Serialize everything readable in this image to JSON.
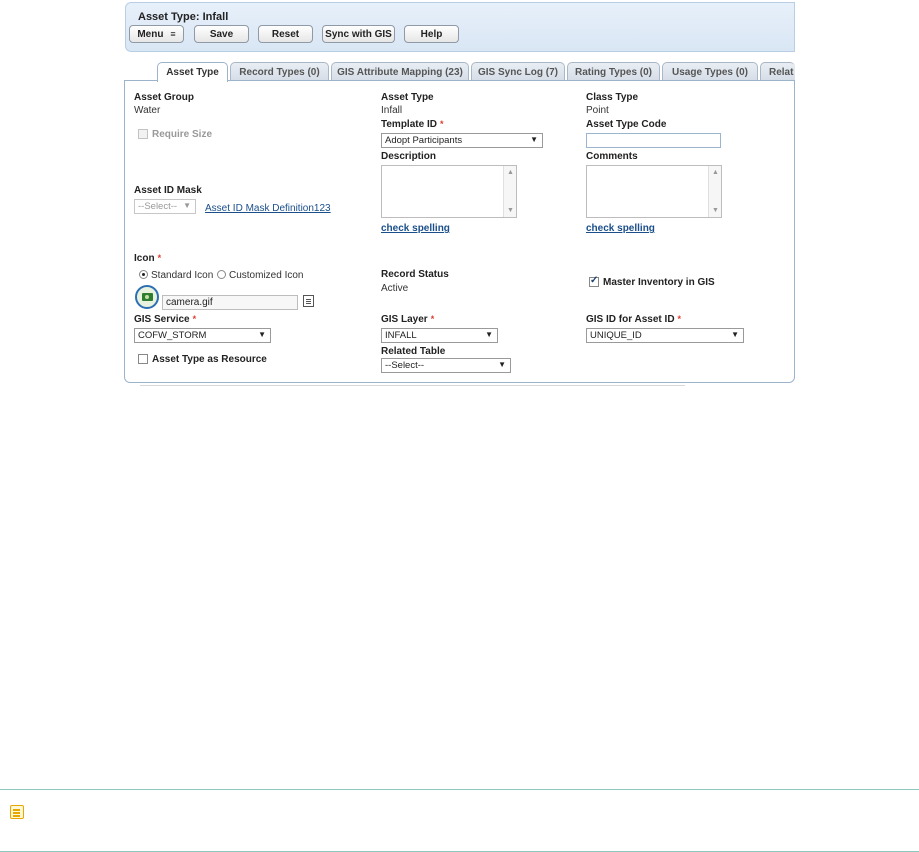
{
  "header": {
    "title": "Asset Type: Infall",
    "buttons": {
      "menu": "Menu",
      "save": "Save",
      "reset": "Reset",
      "sync": "Sync with GIS",
      "help": "Help"
    }
  },
  "tabs": [
    {
      "label": "Asset Type",
      "active": true
    },
    {
      "label": "Record Types (0)"
    },
    {
      "label": "GIS Attribute Mapping (23)"
    },
    {
      "label": "GIS Sync Log (7)"
    },
    {
      "label": "Rating Types (0)"
    },
    {
      "label": "Usage Types (0)"
    },
    {
      "label": "Relat"
    }
  ],
  "form": {
    "asset_group_label": "Asset Group",
    "asset_group_value": "Water",
    "require_size_label": "Require Size",
    "asset_id_mask_label": "Asset ID Mask",
    "asset_id_mask_select": "--Select--",
    "asset_id_mask_link": "Asset ID Mask Definition123",
    "asset_type_label": "Asset Type",
    "asset_type_value": "Infall",
    "template_id_label": "Template ID",
    "template_id_value": "Adopt Participants",
    "description_label": "Description",
    "check_spelling_1": "check spelling",
    "class_type_label": "Class Type",
    "class_type_value": "Point",
    "asset_type_code_label": "Asset Type Code",
    "asset_type_code_value": "",
    "comments_label": "Comments",
    "check_spelling_2": "check spelling",
    "icon_label": "Icon",
    "standard_icon_label": "Standard Icon",
    "customized_icon_label": "Customized Icon",
    "icon_file": "camera.gif",
    "record_status_label": "Record Status",
    "record_status_value": "Active",
    "master_inventory_label": "Master Inventory in GIS",
    "gis_service_label": "GIS Service",
    "gis_service_value": "COFW_STORM",
    "gis_layer_label": "GIS Layer",
    "gis_layer_value": "INFALL",
    "gis_id_label": "GIS ID for Asset ID",
    "gis_id_value": "UNIQUE_ID",
    "asset_type_resource_label": "Asset Type as Resource",
    "related_table_label": "Related Table",
    "related_table_value": "--Select--",
    "required_marker": "*"
  },
  "colors": {
    "accent": "#1a4f8b",
    "required": "#e03c31",
    "header_bg": "#dde8f5",
    "note_border": "#8ec7c0",
    "note_icon": "#e6a700"
  }
}
